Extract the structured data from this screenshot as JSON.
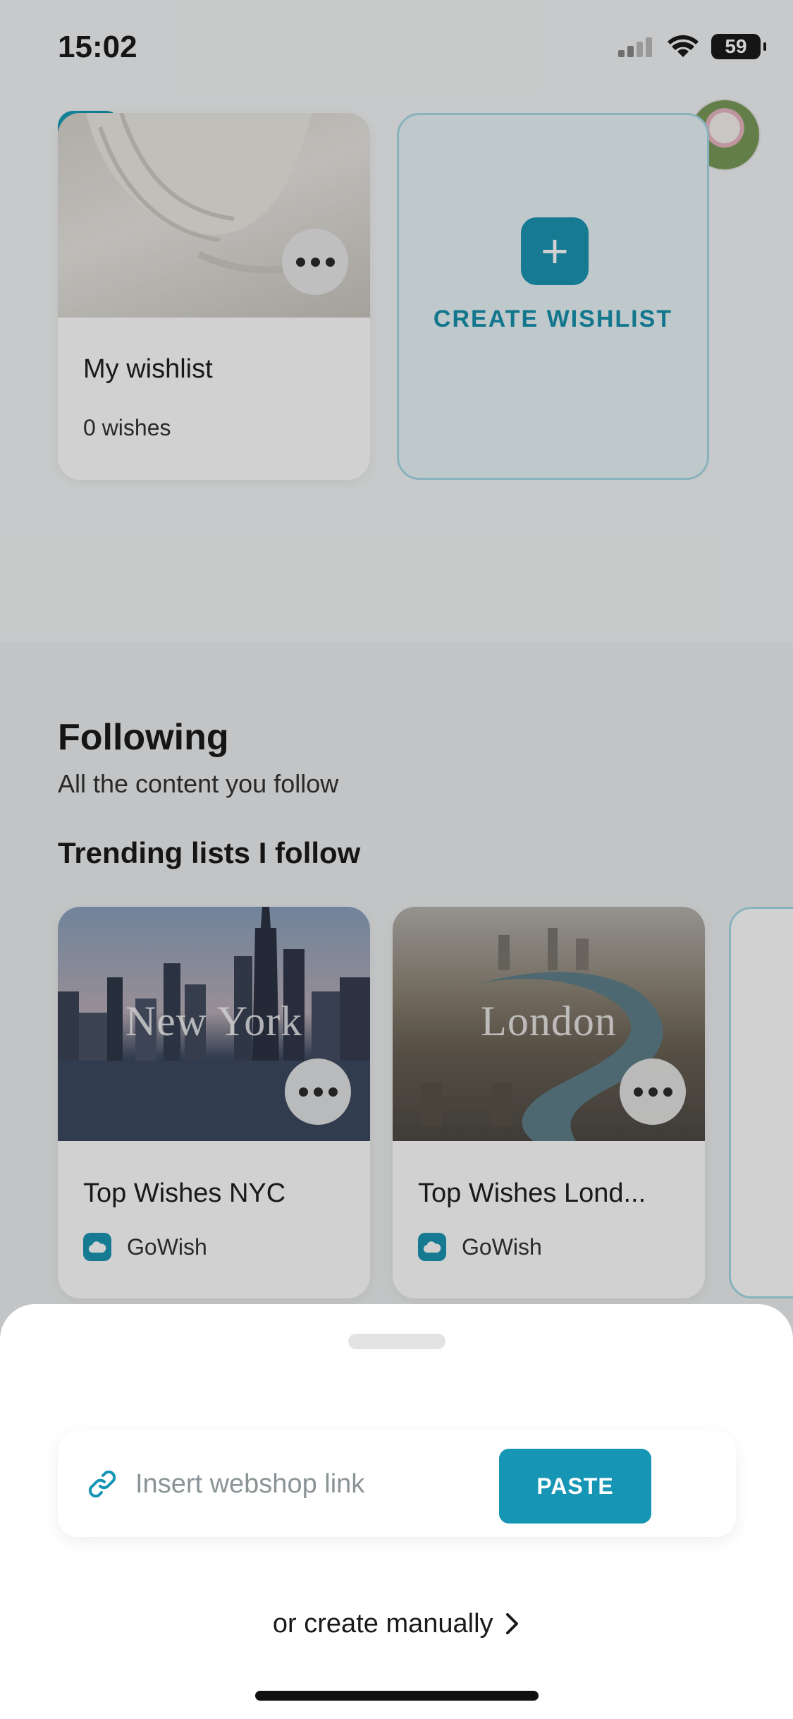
{
  "status_bar": {
    "time": "15:02",
    "battery": "59"
  },
  "header": {
    "logo_icon": "cloud-icon",
    "friends_icon": "people-icon",
    "notifications_icon": "bell-icon"
  },
  "wishlists": [
    {
      "title": "My wishlist",
      "count": "0 wishes"
    }
  ],
  "create_wishlist": {
    "label": "CREATE WISHLIST"
  },
  "following": {
    "title": "Following",
    "subtitle": "All the content you follow",
    "trending_title": "Trending lists I follow",
    "lists": [
      {
        "image_label": "New York",
        "title": "Top Wishes NYC",
        "owner": "GoWish"
      },
      {
        "image_label": "London",
        "title": "Top Wishes Lond...",
        "owner": "GoWish"
      }
    ]
  },
  "sheet": {
    "input_placeholder": "Insert webshop link",
    "paste_label": "PASTE",
    "manual_label": "or create manually"
  },
  "colors": {
    "accent": "#1696b4",
    "accent_light": "#a6dbe6"
  }
}
